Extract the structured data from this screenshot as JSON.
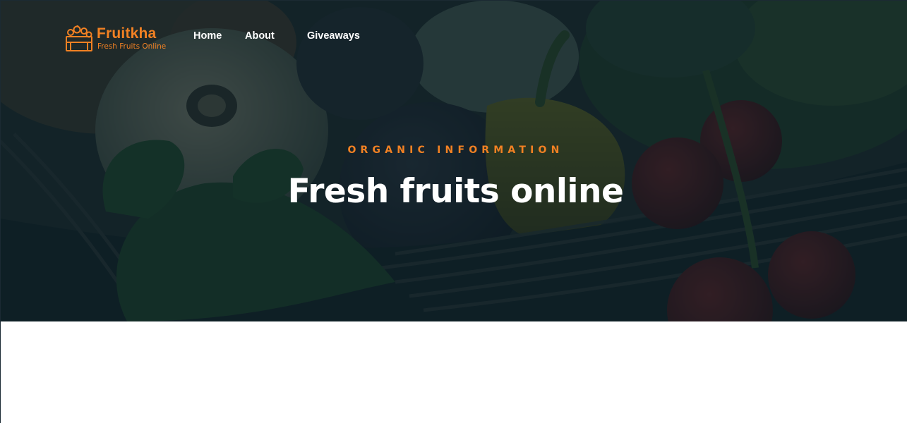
{
  "brand": {
    "name": "Fruitkha",
    "tagline": "Fresh Fruits Online",
    "logo_icon": "fruit-crate-icon"
  },
  "nav": {
    "items": [
      {
        "label": "Home"
      },
      {
        "label": "About"
      },
      {
        "label": "Giveaways"
      }
    ]
  },
  "hero": {
    "subtitle": "ORGANIC INFORMATION",
    "title": "Fresh fruits online",
    "background": "vegetable-basket-photo"
  },
  "colors": {
    "accent": "#f28123",
    "overlay": "#051922",
    "text": "#ffffff"
  }
}
